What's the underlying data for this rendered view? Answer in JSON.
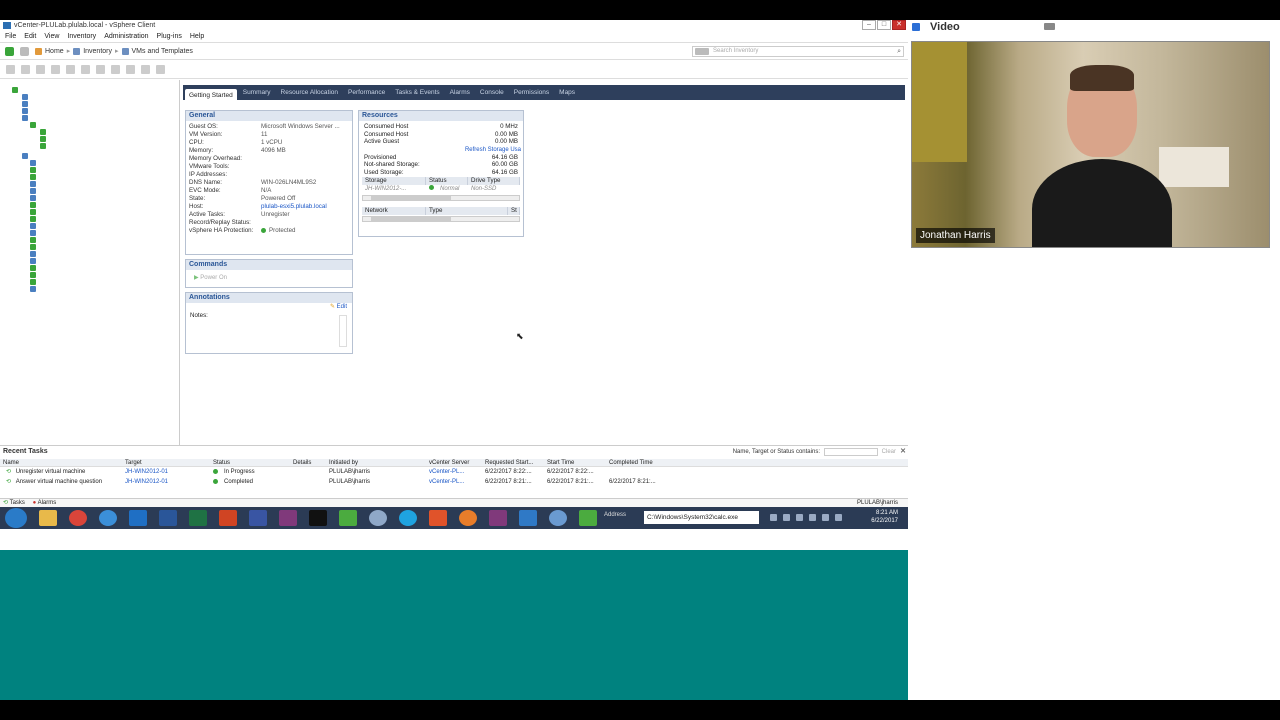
{
  "window": {
    "title": "vCenter-PLULab.plulab.local - vSphere Client"
  },
  "menu": [
    "File",
    "Edit",
    "View",
    "Inventory",
    "Administration",
    "Plug-ins",
    "Help"
  ],
  "breadcrumb": {
    "home": "Home",
    "inventory": "Inventory",
    "vms": "VMs and Templates"
  },
  "search": {
    "placeholder": "Search Inventory"
  },
  "tabs": [
    "Getting Started",
    "Summary",
    "Resource Allocation",
    "Performance",
    "Tasks & Events",
    "Alarms",
    "Console",
    "Permissions",
    "Maps"
  ],
  "general": {
    "title": "General",
    "rows": [
      {
        "k": "Guest OS:",
        "v": "Microsoft Windows Server ..."
      },
      {
        "k": "VM Version:",
        "v": "11"
      },
      {
        "k": "CPU:",
        "v": "1 vCPU"
      },
      {
        "k": "Memory:",
        "v": "4096 MB"
      },
      {
        "k": "Memory Overhead:",
        "v": ""
      },
      {
        "k": "",
        "v": ""
      },
      {
        "k": "VMware Tools:",
        "v": ""
      },
      {
        "k": "IP Addresses:",
        "v": ""
      },
      {
        "k": "",
        "v": ""
      },
      {
        "k": "DNS Name:",
        "v": "WIN-026LN4ML9S2"
      },
      {
        "k": "EVC Mode:",
        "v": "N/A"
      },
      {
        "k": "",
        "v": ""
      },
      {
        "k": "State:",
        "v": "Powered Off"
      },
      {
        "k": "Host:",
        "v": "plulab-esxi5.plulab.local"
      },
      {
        "k": "Active Tasks:",
        "v": "Unregister"
      },
      {
        "k": "Record/Replay Status:",
        "v": ""
      },
      {
        "k": "vSphere HA Protection:",
        "v": "Protected"
      }
    ]
  },
  "commands": {
    "title": "Commands",
    "power_on": "Power On"
  },
  "annotations": {
    "title": "Annotations",
    "edit": "Edit",
    "notes": "Notes:"
  },
  "resources": {
    "title": "Resources",
    "rows": [
      {
        "k": "Consumed Host",
        "v": "0 MHz"
      },
      {
        "k": "Consumed Host",
        "v": "0.00 MB"
      },
      {
        "k": "Active Guest",
        "v": "0.00 MB"
      }
    ],
    "refresh": "Refresh Storage Usa",
    "storage_rows": [
      {
        "k": "Provisioned",
        "v": "64.16 GB"
      },
      {
        "k": "Not-shared Storage:",
        "v": "60.00 GB"
      },
      {
        "k": "Used Storage:",
        "v": "64.16 GB"
      }
    ],
    "storage_headers": [
      "Storage",
      "Status",
      "Drive Type"
    ],
    "storage_item": {
      "name": "JH-WIN2012-...",
      "status": "Normal",
      "drive": "Non-SSD"
    },
    "network_headers": [
      "Network",
      "Type",
      "St"
    ]
  },
  "recent_tasks": {
    "title": "Recent Tasks",
    "filter_label": "Name, Target or Status contains:",
    "clear": "Clear",
    "headers": [
      "Name",
      "Target",
      "Status",
      "Details",
      "Initiated by",
      "vCenter Server",
      "Requested Start...",
      "Start Time",
      "Completed Time"
    ],
    "rows": [
      {
        "name": "Unregister virtual machine",
        "target": "JH-WIN2012-01",
        "status": "In Progress",
        "details": "",
        "by": "PLULAB\\jharris",
        "vc": "vCenter-PL...",
        "req": "6/22/2017 8:22:...",
        "start": "6/22/2017 8:22:...",
        "done": ""
      },
      {
        "name": "Answer virtual machine question",
        "target": "JH-WIN2012-01",
        "status": "Completed",
        "details": "",
        "by": "PLULAB\\jharris",
        "vc": "vCenter-PL...",
        "req": "6/22/2017 8:21:...",
        "start": "6/22/2017 8:21:...",
        "done": "6/22/2017 8:21:..."
      }
    ]
  },
  "statusbar": {
    "tasks": "Tasks",
    "alarms": "Alarms",
    "user": "PLULAB\\jharris"
  },
  "taskbar": {
    "address_label": "Address",
    "address": "C:\\Windows\\System32\\calc.exe",
    "time": "8:21 AM",
    "date": "6/22/2017"
  },
  "video": {
    "title": "Video",
    "name": "Jonathan Harris"
  }
}
